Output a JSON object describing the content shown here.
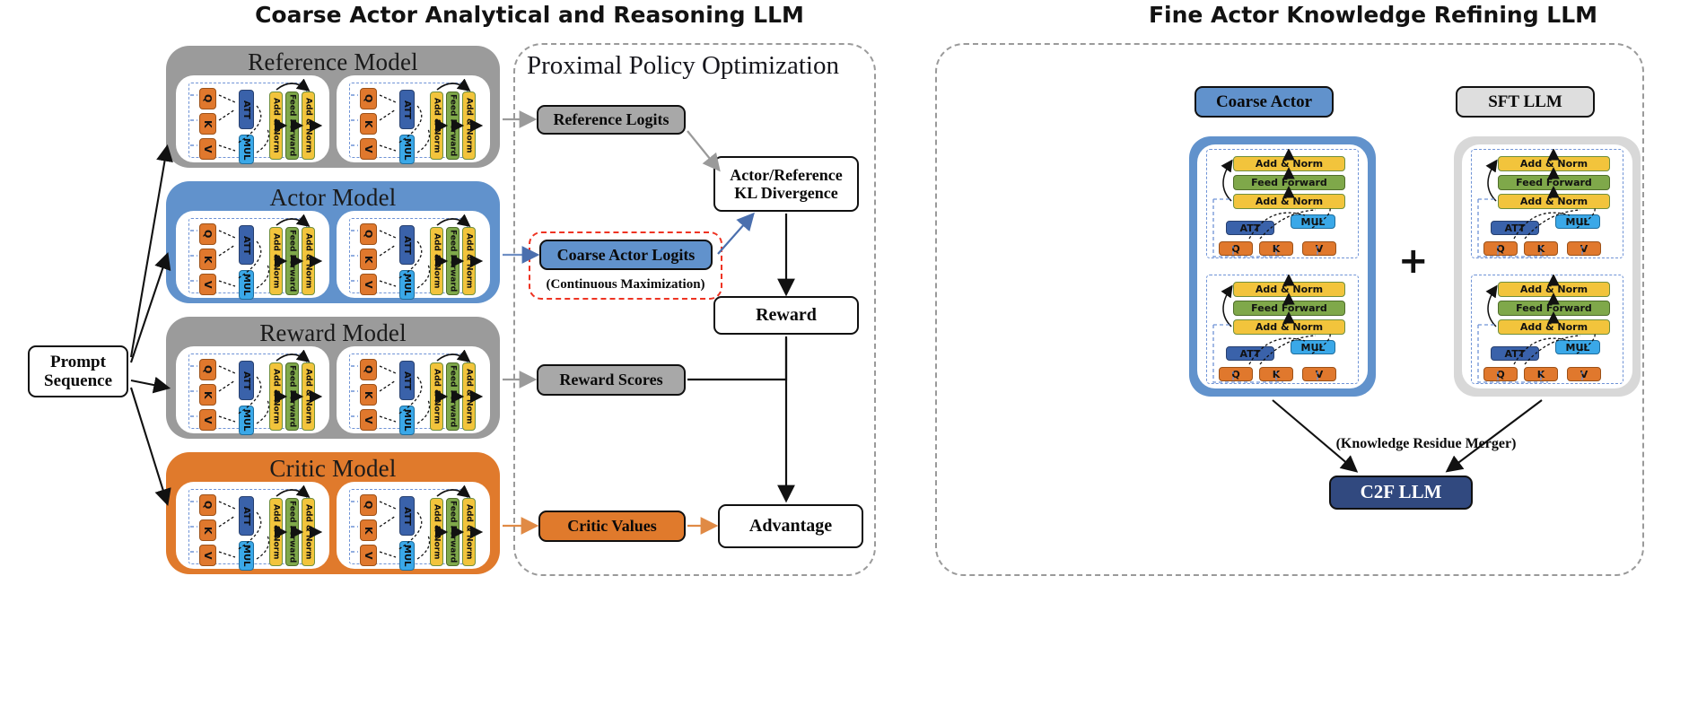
{
  "titles": {
    "left": "Coarse Actor Analytical and Reasoning LLM",
    "right": "Fine Actor Knowledge Refining LLM"
  },
  "left_panel": {
    "prompt_node": "Prompt Sequence",
    "models": [
      {
        "label": "Reference Model",
        "color": "#9b9b9b",
        "accent": "grey"
      },
      {
        "label": "Actor Model",
        "color": "#6192cc",
        "accent": "blue"
      },
      {
        "label": "Reward Model",
        "color": "#9b9b9b",
        "accent": "grey"
      },
      {
        "label": "Critic Model",
        "color": "#e07a2c",
        "accent": "orange"
      }
    ]
  },
  "transformer_unit": {
    "blocks": [
      "Q",
      "K",
      "V",
      "ATT",
      "MUL",
      "Add & Norm",
      "Feed Forward",
      "Add & Norm"
    ],
    "colors": {
      "qkv": "#e0782d",
      "att": "#3a62aa",
      "mul": "#3aa8e8",
      "add_norm": "#f2c43c",
      "feed_forward": "#7fa84a"
    },
    "labels": {
      "q": "Q",
      "k": "K",
      "v": "V",
      "att": "ATT",
      "mul": "MUL",
      "add_norm": "Add & Norm",
      "feed_forward": "Feed Forward"
    }
  },
  "ppo": {
    "title": "Proximal Policy Optimization",
    "nodes": {
      "reference_logits": "Reference Logits",
      "coarse_actor_logits": "Coarse Actor Logits",
      "coarse_actor_caption": "(Continuous Maximization)",
      "kl_divergence_line1": "Actor/Reference",
      "kl_divergence_line2": "KL Divergence",
      "reward": "Reward",
      "reward_scores": "Reward Scores",
      "critic_values": "Critic Values",
      "advantage": "Advantage"
    }
  },
  "right_panel": {
    "coarse_actor": "Coarse Actor",
    "sft_llm": "SFT LLM",
    "plus": "+",
    "merger_caption": "(Knowledge Residue Merger)",
    "c2f_llm": "C2F LLM"
  }
}
